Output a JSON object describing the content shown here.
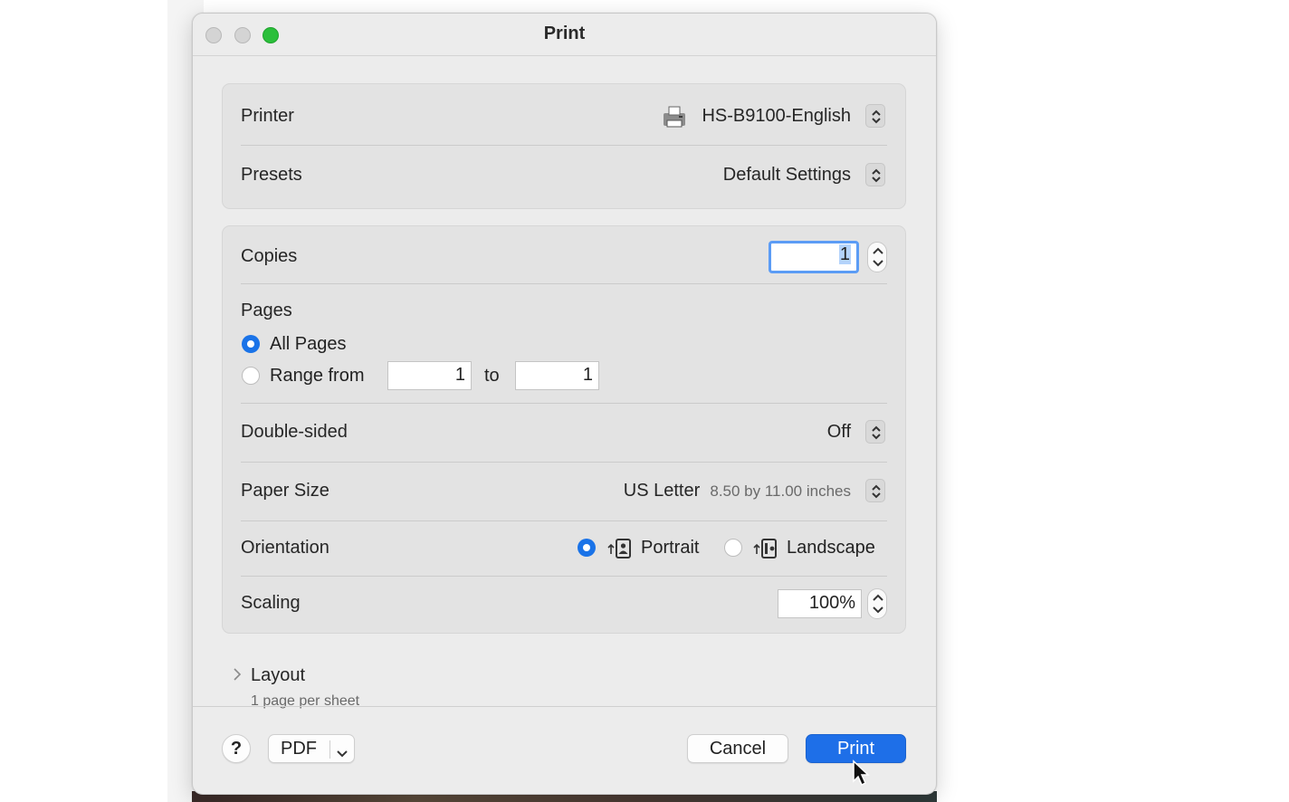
{
  "window": {
    "title": "Print"
  },
  "printer": {
    "label": "Printer",
    "value": "HS-B9100-English",
    "icon": "printer-icon"
  },
  "presets": {
    "label": "Presets",
    "value": "Default Settings"
  },
  "copies": {
    "label": "Copies",
    "value": "1"
  },
  "pages": {
    "label": "Pages",
    "all_label": "All Pages",
    "range_label": "Range from",
    "range_from": "1",
    "to_label": "to",
    "range_to": "1",
    "selected": "all"
  },
  "double_sided": {
    "label": "Double-sided",
    "value": "Off"
  },
  "paper_size": {
    "label": "Paper Size",
    "value": "US Letter",
    "detail": "8.50 by 11.00 inches"
  },
  "orientation": {
    "label": "Orientation",
    "portrait_label": "Portrait",
    "landscape_label": "Landscape",
    "selected": "portrait"
  },
  "scaling": {
    "label": "Scaling",
    "value": "100%"
  },
  "layout": {
    "label": "Layout",
    "summary": "1 page per sheet"
  },
  "footer": {
    "help_label": "?",
    "pdf_label": "PDF",
    "cancel_label": "Cancel",
    "print_label": "Print"
  },
  "colors": {
    "accent": "#1e6fe8",
    "zoom_green": "#2bbf3b"
  }
}
